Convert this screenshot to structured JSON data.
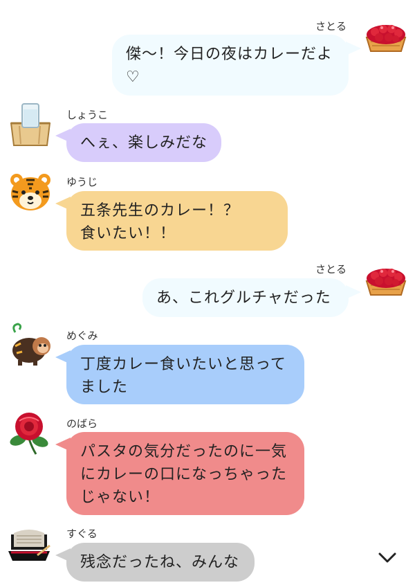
{
  "messages": [
    {
      "sender": "さとる",
      "text": "傑〜！今日の夜はカレーだよ\n♡",
      "side": "right",
      "avatar_icon": "tart-icon",
      "color": "#f1fbff"
    },
    {
      "sender": "しょうこ",
      "text": "へぇ、楽しみだな",
      "side": "left",
      "avatar_icon": "sake-cup-icon",
      "color": "#d8ccfb"
    },
    {
      "sender": "ゆうじ",
      "text": "五条先生のカレー！？\n食いたい！！",
      "side": "left",
      "avatar_icon": "tiger-icon",
      "color": "#f8d692"
    },
    {
      "sender": "さとる",
      "text": "あ、これグルチャだった",
      "side": "right",
      "avatar_icon": "tart-icon",
      "color": "#f1fbff"
    },
    {
      "sender": "めぐみ",
      "text": "丁度カレー食いたいと思って\nました",
      "side": "left",
      "avatar_icon": "monkey-icon",
      "color": "#a8cdfb"
    },
    {
      "sender": "のばら",
      "text": "パスタの気分だったのに一気\nにカレーの口になっちゃった\nじゃない！",
      "side": "left",
      "avatar_icon": "camellia-icon",
      "color": "#f08b8b"
    },
    {
      "sender": "すぐる",
      "text": "残念だったね、みんな",
      "side": "left",
      "avatar_icon": "soba-icon",
      "color": "#cdcdcd"
    }
  ],
  "scroll_down_icon": "chevron-down-icon"
}
